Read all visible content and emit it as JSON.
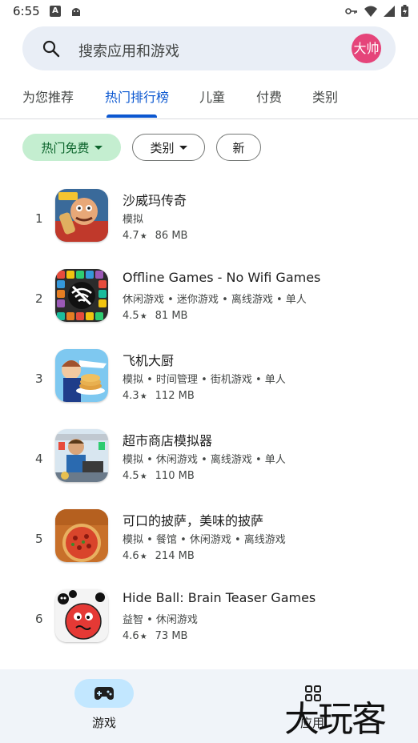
{
  "status_bar": {
    "time": "6:55",
    "badge": "A"
  },
  "search": {
    "placeholder": "搜索应用和游戏",
    "avatar_text": "大帅"
  },
  "tabs": [
    {
      "label": "为您推荐"
    },
    {
      "label": "热门排行榜"
    },
    {
      "label": "儿童"
    },
    {
      "label": "付费"
    },
    {
      "label": "类别"
    }
  ],
  "active_tab": "热门排行榜",
  "chips": [
    {
      "label": "热门免费"
    },
    {
      "label": "类别"
    },
    {
      "label": "新"
    }
  ],
  "apps": [
    {
      "rank": "1",
      "title": "沙威玛传奇",
      "categories": "模拟",
      "rating": "4.7",
      "size": "86 MB",
      "icon": "shawarma-legend-icon"
    },
    {
      "rank": "2",
      "title": "Offline Games - No Wifi Games",
      "categories": "休闲游戏 • 迷你游戏 • 离线游戏 • 单人",
      "rating": "4.5",
      "size": "81 MB",
      "icon": "offline-games-icon"
    },
    {
      "rank": "3",
      "title": "飞机大厨",
      "categories": "模拟 • 时间管理 • 街机游戏 • 单人",
      "rating": "4.3",
      "size": "112 MB",
      "icon": "airplane-chef-icon"
    },
    {
      "rank": "4",
      "title": "超市商店模拟器",
      "categories": "模拟 • 休闲游戏 • 离线游戏 • 单人",
      "rating": "4.5",
      "size": "110 MB",
      "icon": "supermarket-simulator-icon"
    },
    {
      "rank": "5",
      "title": "可口的披萨，美味的披萨",
      "categories": "模拟 • 餐馆 • 休闲游戏 • 离线游戏",
      "rating": "4.6",
      "size": "214 MB",
      "icon": "pizza-icon"
    },
    {
      "rank": "6",
      "title": "Hide Ball: Brain Teaser Games",
      "categories": "益智 • 休闲游戏",
      "rating": "4.6",
      "size": "73 MB",
      "icon": "hide-ball-icon"
    }
  ],
  "bottom_nav": [
    {
      "label": "游戏",
      "icon": "gamepad-icon"
    },
    {
      "label": "应用",
      "icon": "apps-grid-icon"
    }
  ],
  "watermark": "大玩客",
  "colors": {
    "accent": "#0b57d0",
    "chip_selected_bg": "#c4eed0",
    "nav_pill": "#c2e7ff",
    "avatar_bg": "#e5447a"
  }
}
